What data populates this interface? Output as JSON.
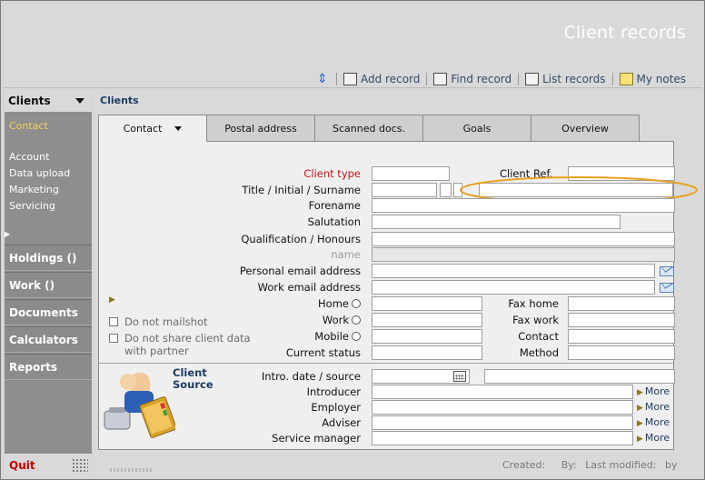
{
  "app_title": "Client records",
  "toolbar": {
    "add_record": "Add record",
    "find_record": "Find record",
    "list_records": "List records",
    "my_notes": "My notes"
  },
  "sidebar": {
    "header": "Clients",
    "sub_items": [
      "Contact",
      "Account",
      "Data upload",
      "Marketing",
      "Servicing"
    ],
    "sections": [
      "Holdings ()",
      "Work ()",
      "Documents",
      "Calculators",
      "Reports"
    ],
    "quit": "Quit"
  },
  "breadcrumb": "Clients",
  "tabs": [
    "Contact",
    "Postal address",
    "Scanned docs.",
    "Goals",
    "Overview"
  ],
  "form": {
    "client_type": "Client type",
    "client_ref": "Client Ref.",
    "title_initial_surname": "Title / Initial / Surname",
    "forename": "Forename",
    "salutation": "Salutation",
    "qualification": "Qualification / Honours",
    "name": "name",
    "personal_email": "Personal email address",
    "work_email": "Work email address",
    "home": "Home",
    "work": "Work",
    "mobile": "Mobile",
    "current_status": "Current status",
    "fax_home": "Fax home",
    "fax_work": "Fax work",
    "contact": "Contact",
    "method": "Method",
    "do_not_mailshot": "Do not mailshot",
    "do_not_share_1": "Do not share client data",
    "do_not_share_2": "with partner",
    "client_source_1": "Client",
    "client_source_2": "Source",
    "intro_date": "Intro. date / source",
    "introducer": "Introducer",
    "employer": "Employer",
    "adviser": "Adviser",
    "service_manager": "Service manager",
    "more": "More"
  },
  "status_bar": {
    "created": "Created:",
    "by": "By:",
    "last_modified": "Last modified:",
    "by2": "by"
  },
  "colors": {
    "highlight_ellipse": "#e8a020",
    "required_label": "#c01818",
    "active_sidebar": "#f4d25b"
  }
}
